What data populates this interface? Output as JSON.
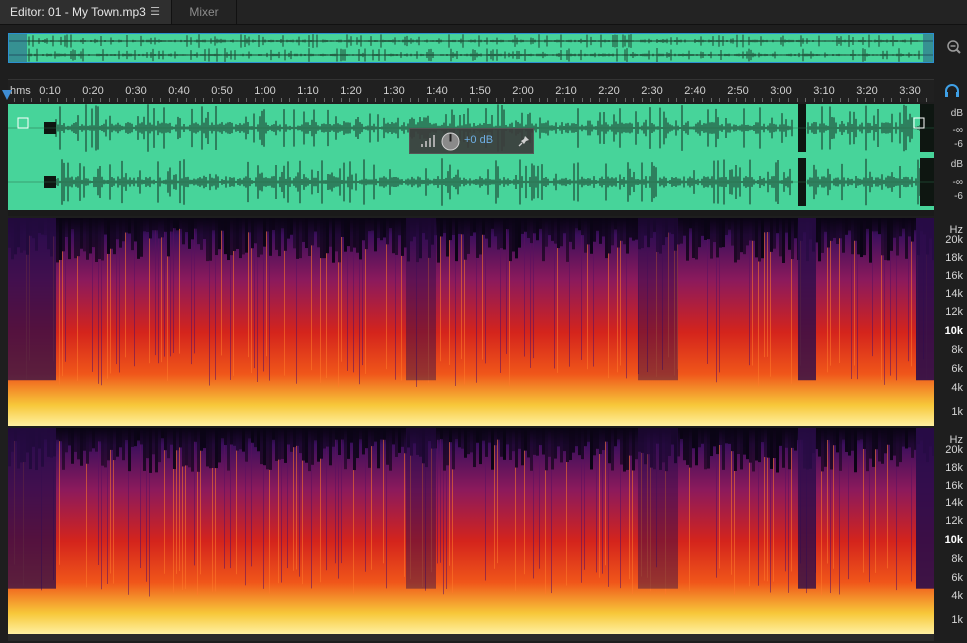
{
  "tabs": {
    "editor_label": "Editor: 01 - My Town.mp3",
    "mixer_label": "Mixer"
  },
  "ruler": {
    "unit_label": "hms",
    "ticks": [
      "0:10",
      "0:20",
      "0:30",
      "0:40",
      "0:50",
      "1:00",
      "1:10",
      "1:20",
      "1:30",
      "1:40",
      "1:50",
      "2:00",
      "2:10",
      "2:20",
      "2:30",
      "2:40",
      "2:50",
      "3:00",
      "3:10",
      "3:20",
      "3:30"
    ]
  },
  "hud": {
    "volume_label": "+0 dB"
  },
  "db_scale": {
    "upper": [
      "dB",
      "-∞",
      "-6"
    ],
    "lower": [
      "dB",
      "-∞",
      "-6"
    ]
  },
  "hz_scale": {
    "labels": [
      "Hz",
      "20k",
      "18k",
      "16k",
      "14k",
      "12k",
      "10k",
      "8k",
      "6k",
      "4k",
      "1k"
    ]
  },
  "colors": {
    "waveform_bg": "#47d49a",
    "accent_blue": "#3f8ed6"
  },
  "icons": [
    "menu-icon",
    "zoom-icon",
    "headphone-icon",
    "volume-bars-icon",
    "knob-icon",
    "pin-icon"
  ]
}
